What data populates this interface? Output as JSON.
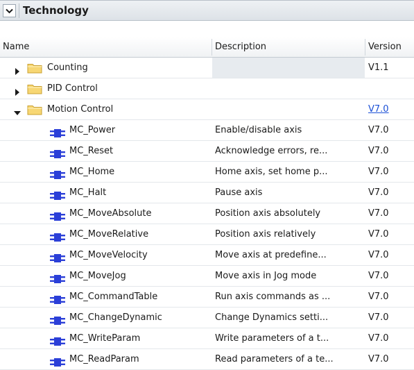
{
  "panel": {
    "title": "Technology",
    "collapse_icon": "chevron-down-icon"
  },
  "columns": {
    "name": "Name",
    "description": "Description",
    "version": "Version"
  },
  "folders": [
    {
      "name": "Counting",
      "description": "",
      "version": "V1.1",
      "expanded": false,
      "icon": "folder-icon"
    },
    {
      "name": "PID Control",
      "description": "",
      "version": "",
      "expanded": false,
      "icon": "folder-icon"
    },
    {
      "name": "Motion Control",
      "description": "",
      "version": "V7.0",
      "expanded": true,
      "icon": "folder-icon",
      "version_is_link": true
    }
  ],
  "blocks": [
    {
      "name": "MC_Power",
      "description": "Enable/disable axis",
      "version": "V7.0",
      "icon": "function-block-icon"
    },
    {
      "name": "MC_Reset",
      "description": "Acknowledge errors, re...",
      "version": "V7.0",
      "icon": "function-block-icon"
    },
    {
      "name": "MC_Home",
      "description": "Home axis, set home p...",
      "version": "V7.0",
      "icon": "function-block-icon"
    },
    {
      "name": "MC_Halt",
      "description": "Pause axis",
      "version": "V7.0",
      "icon": "function-block-icon"
    },
    {
      "name": "MC_MoveAbsolute",
      "description": "Position axis absolutely",
      "version": "V7.0",
      "icon": "function-block-icon"
    },
    {
      "name": "MC_MoveRelative",
      "description": "Position axis relatively",
      "version": "V7.0",
      "icon": "function-block-icon"
    },
    {
      "name": "MC_MoveVelocity",
      "description": "Move axis at predefine...",
      "version": "V7.0",
      "icon": "function-block-icon"
    },
    {
      "name": "MC_MoveJog",
      "description": "Move axis in Jog mode",
      "version": "V7.0",
      "icon": "function-block-icon"
    },
    {
      "name": "MC_CommandTable",
      "description": "Run axis commands as ...",
      "version": "V7.0",
      "icon": "function-block-icon"
    },
    {
      "name": "MC_ChangeDynamic",
      "description": "Change Dynamics setti...",
      "version": "V7.0",
      "icon": "function-block-icon"
    },
    {
      "name": "MC_WriteParam",
      "description": "Write parameters of a t...",
      "version": "V7.0",
      "icon": "function-block-icon"
    },
    {
      "name": "MC_ReadParam",
      "description": "Read parameters of a te...",
      "version": "V7.0",
      "icon": "function-block-icon"
    }
  ],
  "colors": {
    "link": "#1a4fd6",
    "fb_icon": "#2b3fd8",
    "folder_fill": "#f7d774",
    "folder_stroke": "#c9a032"
  }
}
